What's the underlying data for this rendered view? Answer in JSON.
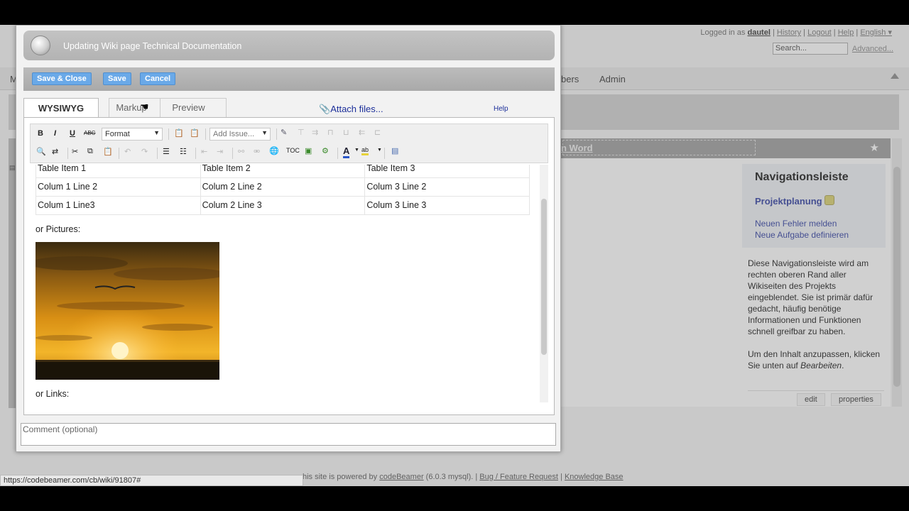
{
  "background": {
    "logged_in_label": "Logged in as",
    "user": "dautel",
    "links": [
      "History",
      "Logout",
      "Help",
      "English ▾"
    ],
    "search_placeholder": "Search...",
    "advanced_label": "Advanced...",
    "nav_items": [
      "M",
      "bers",
      "Admin"
    ],
    "word_link": "n Word",
    "nav_box": {
      "title": "Navigationsleiste",
      "project": "Projektplanung",
      "links": [
        "Neuen Fehler melden",
        "Neue Aufgabe definieren"
      ]
    },
    "description_p1": "Diese Navigationsleiste wird am rechten oberen Rand aller Wikiseiten des Projekts eingeblendet. Sie ist primär dafür gedacht, häufig benötige Informationen und Funktionen schnell greifbar zu haben.",
    "description_p2_prefix": "Um den Inhalt anzupassen, klicken Sie unten auf ",
    "description_p2_em": "Bearbeiten",
    "description_p2_suffix": ".",
    "buttons": {
      "edit": "edit",
      "properties": "properties"
    },
    "footer_prefix": "his site is powered by",
    "footer_product": "codeBeamer",
    "footer_version": "(6.0.3 mysql).",
    "footer_bug": "Bug / Feature Request",
    "footer_kb": "Knowledge Base",
    "status_url": "https://codebeamer.com/cb/wiki/91807#"
  },
  "dialog": {
    "title": "Updating Wiki page Technical Documentation",
    "buttons": {
      "save_close": "Save & Close",
      "save": "Save",
      "cancel": "Cancel"
    },
    "tabs": [
      "WYSIWYG",
      "Markup",
      "Preview"
    ],
    "active_tab": "WYSIWYG",
    "attach_label": "Attach files...",
    "help_label": "Help",
    "toolbar": {
      "bold": "B",
      "italic": "I",
      "underline": "U",
      "strike": "ABC",
      "format": "Format",
      "add_issue": "Add Issue..."
    },
    "content": {
      "table": [
        [
          "Table Item 1",
          "Table Item 2",
          "Table Item 3"
        ],
        [
          "Colum 1 Line 2",
          "Colum 2 Line 2",
          "Colum 3 Line 2"
        ],
        [
          "Colum 1 Line3",
          "Colum 2 Line 3",
          "Colum 3 Line 3"
        ]
      ],
      "pictures_label": "or Pictures:",
      "links_label": "or Links:"
    },
    "comment_placeholder": "Comment (optional)"
  }
}
